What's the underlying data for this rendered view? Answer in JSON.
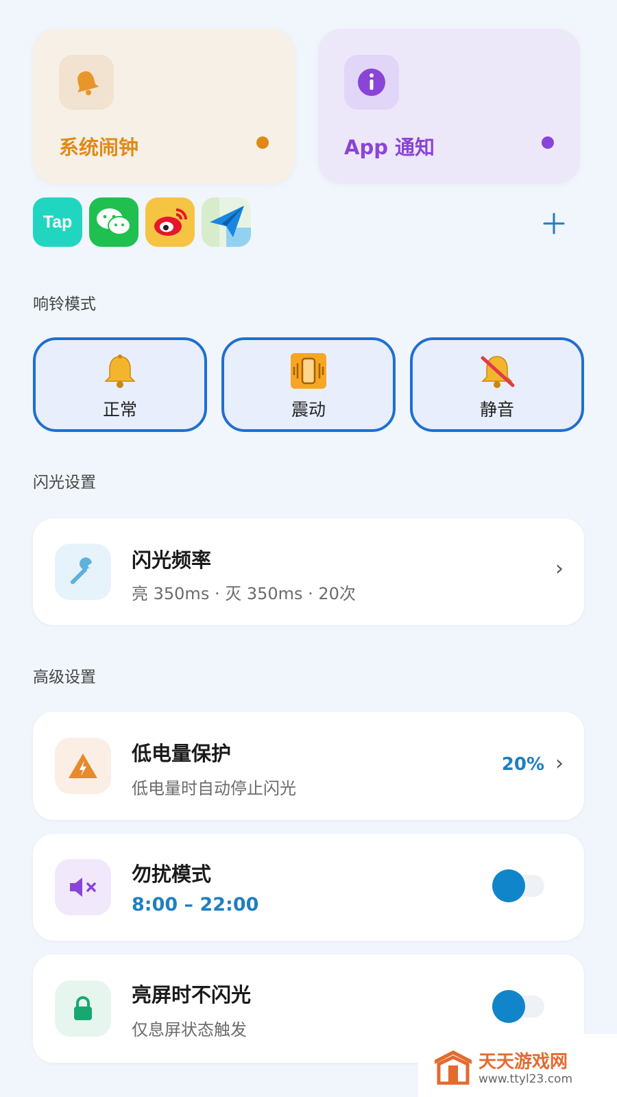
{
  "cards": {
    "alarm": {
      "title": "系统闹钟",
      "icon": "bell-icon",
      "accent": "#df8a17"
    },
    "app": {
      "title": "App 通知",
      "icon": "info-icon",
      "accent": "#8a44d8"
    }
  },
  "apps": [
    {
      "name": "Tap",
      "icon": "taptap-app-icon"
    },
    {
      "name": "微信",
      "icon": "wechat-app-icon"
    },
    {
      "name": "微博",
      "icon": "weibo-app-icon"
    },
    {
      "name": "飞书",
      "icon": "paper-plane-app-icon"
    }
  ],
  "ring": {
    "section_title": "响铃模式",
    "modes": [
      {
        "label": "正常",
        "icon": "bell-icon"
      },
      {
        "label": "震动",
        "icon": "vibrate-icon"
      },
      {
        "label": "静音",
        "icon": "muted-bell-icon"
      }
    ]
  },
  "flash": {
    "section_title": "闪光设置",
    "frequency": {
      "title": "闪光频率",
      "subtitle": "亮 350ms · 灭 350ms · 20次",
      "icon": "wrench-icon"
    }
  },
  "advanced": {
    "section_title": "高级设置",
    "low_battery": {
      "title": "低电量保护",
      "subtitle": "低电量时自动停止闪光",
      "value": "20%",
      "icon": "warning-icon"
    },
    "dnd": {
      "title": "勿扰模式",
      "subtitle": "8:00 – 22:00",
      "icon": "mute-speaker-icon",
      "enabled": true
    },
    "screen_on": {
      "title": "亮屏时不闪光",
      "subtitle": "仅息屏状态触发",
      "icon": "lock-icon",
      "enabled": true
    }
  },
  "watermark": {
    "name": "天天游戏网",
    "url": "www.ttyl23.com"
  }
}
